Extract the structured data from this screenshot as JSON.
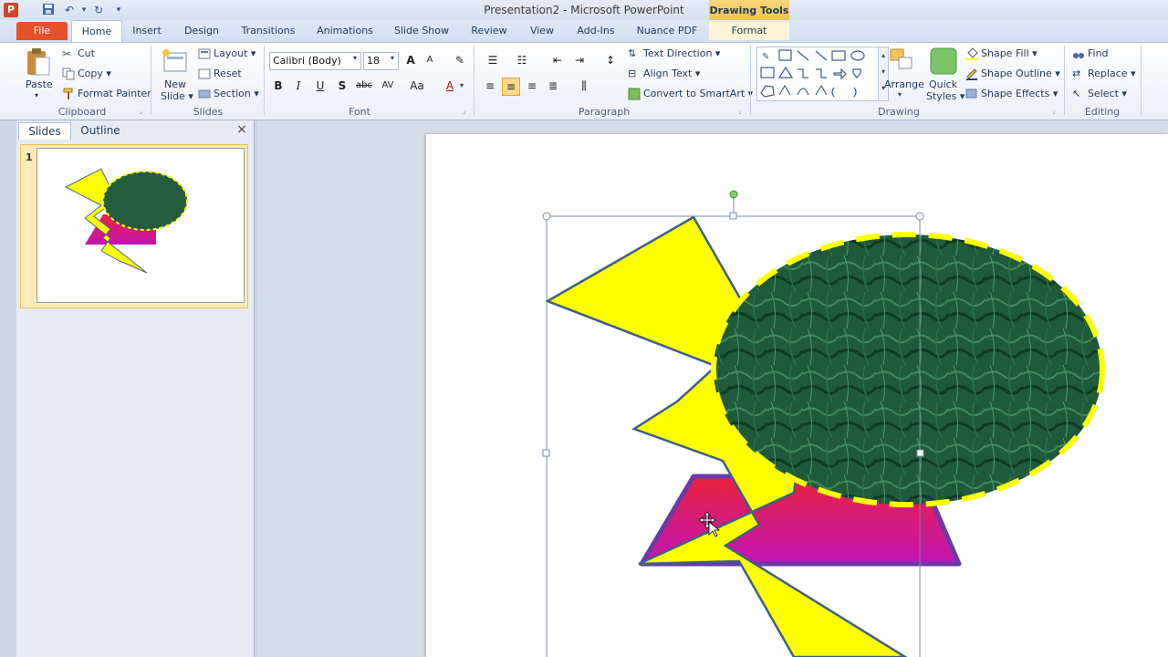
{
  "window": {
    "title": "Presentation2  -  Microsoft PowerPoint",
    "app_icon": "P",
    "contextual_tab": "Drawing Tools"
  },
  "qat": {
    "save": "save-icon",
    "undo": "undo-icon",
    "redo": "redo-icon",
    "customize": "dropdown-icon"
  },
  "tabs": [
    "File",
    "Home",
    "Insert",
    "Design",
    "Transitions",
    "Animations",
    "Slide Show",
    "Review",
    "View",
    "Add-Ins",
    "Nuance PDF",
    "Format"
  ],
  "ribbon": {
    "clipboard": {
      "paste": "Paste",
      "cut": "Cut",
      "copy": "Copy",
      "format_painter": "Format Painter",
      "label": "Clipboard"
    },
    "slides": {
      "new_slide_1": "New",
      "new_slide_2": "Slide",
      "layout": "Layout",
      "reset": "Reset",
      "section": "Section",
      "label": "Slides"
    },
    "font": {
      "family": "Calibri (Body)",
      "size": "18",
      "bold": "B",
      "italic": "I",
      "underline": "U",
      "shadow": "S",
      "strike": "abc",
      "spacing": "AV",
      "case": "Aa",
      "color": "A",
      "grow": "A",
      "shrink": "A",
      "label": "Font"
    },
    "paragraph": {
      "text_direction": "Text Direction",
      "align_text": "Align Text",
      "convert_smartart": "Convert to SmartArt",
      "label": "Paragraph"
    },
    "drawing": {
      "arrange": "Arrange",
      "quick_styles_1": "Quick",
      "quick_styles_2": "Styles",
      "shape_fill": "Shape Fill",
      "shape_outline": "Shape Outline",
      "shape_effects": "Shape Effects",
      "label": "Drawing"
    },
    "editing": {
      "find": "Find",
      "replace": "Replace",
      "select": "Select",
      "label": "Editing"
    }
  },
  "panel": {
    "tab_slides": "Slides",
    "tab_outline": "Outline",
    "close": "×",
    "slide_number": "1"
  },
  "colors": {
    "accent_file": "#e5522a",
    "lightning": "#ffff00",
    "ellipse_dash": "#ffff00",
    "ellipse_fill": "#1f5a3a",
    "triangle_top": "#e8223c",
    "triangle_bottom": "#c214b8",
    "triangle_edge": "#6a3aa8"
  }
}
